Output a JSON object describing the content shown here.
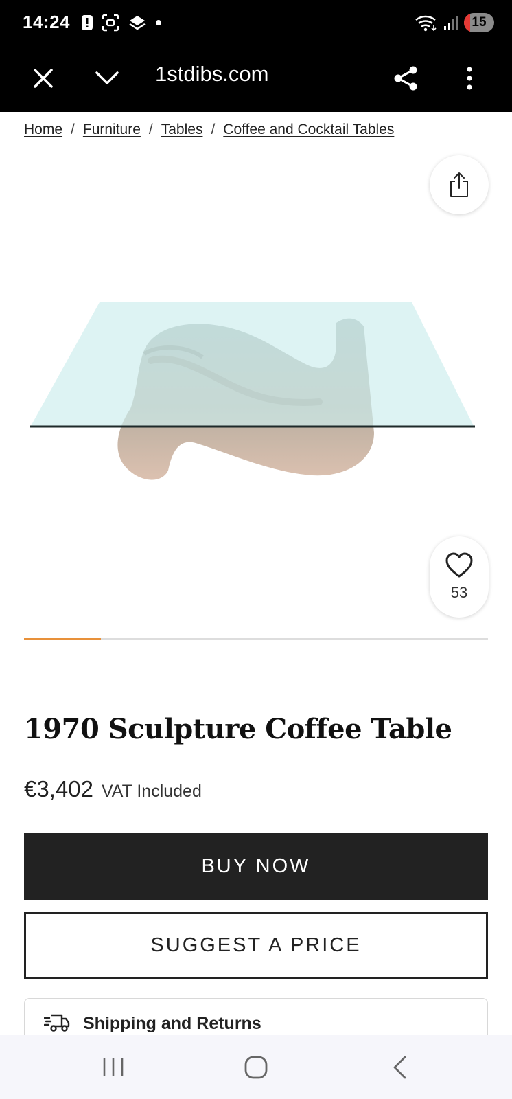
{
  "status_bar": {
    "time": "14:24",
    "battery": "15"
  },
  "browser": {
    "url": "1stdibs.com"
  },
  "breadcrumb": {
    "items": [
      "Home",
      "Furniture",
      "Tables",
      "Coffee and Cocktail Tables"
    ],
    "separator": "/"
  },
  "product": {
    "title": "1970 Sculpture Coffee Table",
    "price": "€3,402",
    "vat_note": "VAT Included",
    "favorites_count": "53",
    "carousel_progress": 0.165
  },
  "actions": {
    "buy_now": "BUY NOW",
    "suggest_price": "SUGGEST A PRICE"
  },
  "shipping": {
    "label": "Shipping and Returns"
  },
  "colors": {
    "accent": "#e8913a",
    "primary_button": "#222222",
    "chrome": "#000000"
  },
  "icons": [
    "close-icon",
    "chevron-down-icon",
    "share-icon",
    "more-vert-icon",
    "upload-share-icon",
    "heart-icon",
    "truck-icon",
    "recents-icon",
    "home-icon",
    "back-icon"
  ]
}
